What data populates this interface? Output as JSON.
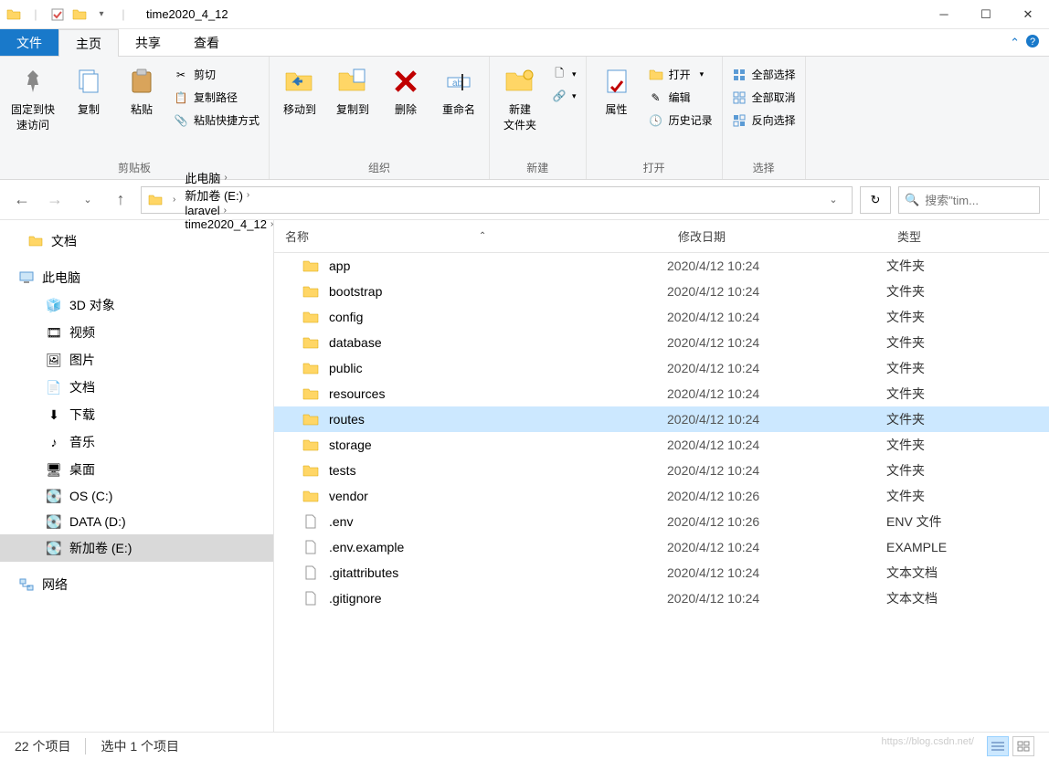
{
  "window": {
    "title": "time2020_4_12"
  },
  "tabs": {
    "file": "文件",
    "home": "主页",
    "share": "共享",
    "view": "查看"
  },
  "ribbon": {
    "clipboard": {
      "pin": "固定到快\n速访问",
      "copy": "复制",
      "paste": "粘贴",
      "cut": "剪切",
      "copypath": "复制路径",
      "paste_shortcut": "粘贴快捷方式",
      "label": "剪贴板"
    },
    "organize": {
      "moveto": "移动到",
      "copyto": "复制到",
      "delete": "删除",
      "rename": "重命名",
      "label": "组织"
    },
    "new": {
      "newfolder": "新建\n文件夹",
      "label": "新建"
    },
    "open": {
      "properties": "属性",
      "open": "打开",
      "edit": "编辑",
      "history": "历史记录",
      "label": "打开"
    },
    "select": {
      "all": "全部选择",
      "none": "全部取消",
      "invert": "反向选择",
      "label": "选择"
    }
  },
  "breadcrumb": {
    "items": [
      "此电脑",
      "新加卷 (E:)",
      "laravel",
      "time2020_4_12"
    ]
  },
  "search": {
    "placeholder": "搜索\"tim..."
  },
  "sidebar": {
    "docs": "文档",
    "pc": "此电脑",
    "items": [
      "3D 对象",
      "视频",
      "图片",
      "文档",
      "下载",
      "音乐",
      "桌面",
      "OS (C:)",
      "DATA (D:)",
      "新加卷 (E:)"
    ],
    "network": "网络"
  },
  "columns": {
    "name": "名称",
    "date": "修改日期",
    "type": "类型"
  },
  "files": [
    {
      "name": "app",
      "date": "2020/4/12 10:24",
      "type": "文件夹",
      "icon": "folder",
      "selected": false
    },
    {
      "name": "bootstrap",
      "date": "2020/4/12 10:24",
      "type": "文件夹",
      "icon": "folder",
      "selected": false
    },
    {
      "name": "config",
      "date": "2020/4/12 10:24",
      "type": "文件夹",
      "icon": "folder",
      "selected": false
    },
    {
      "name": "database",
      "date": "2020/4/12 10:24",
      "type": "文件夹",
      "icon": "folder",
      "selected": false
    },
    {
      "name": "public",
      "date": "2020/4/12 10:24",
      "type": "文件夹",
      "icon": "folder",
      "selected": false
    },
    {
      "name": "resources",
      "date": "2020/4/12 10:24",
      "type": "文件夹",
      "icon": "folder",
      "selected": false
    },
    {
      "name": "routes",
      "date": "2020/4/12 10:24",
      "type": "文件夹",
      "icon": "folder",
      "selected": true
    },
    {
      "name": "storage",
      "date": "2020/4/12 10:24",
      "type": "文件夹",
      "icon": "folder",
      "selected": false
    },
    {
      "name": "tests",
      "date": "2020/4/12 10:24",
      "type": "文件夹",
      "icon": "folder",
      "selected": false
    },
    {
      "name": "vendor",
      "date": "2020/4/12 10:26",
      "type": "文件夹",
      "icon": "folder",
      "selected": false
    },
    {
      "name": ".env",
      "date": "2020/4/12 10:26",
      "type": "ENV 文件",
      "icon": "file",
      "selected": false
    },
    {
      "name": ".env.example",
      "date": "2020/4/12 10:24",
      "type": "EXAMPLE",
      "icon": "file",
      "selected": false
    },
    {
      "name": ".gitattributes",
      "date": "2020/4/12 10:24",
      "type": "文本文档",
      "icon": "file",
      "selected": false
    },
    {
      "name": ".gitignore",
      "date": "2020/4/12 10:24",
      "type": "文本文档",
      "icon": "file",
      "selected": false
    }
  ],
  "status": {
    "count": "22 个项目",
    "selected": "选中 1 个项目"
  },
  "watermark": "https://blog.csdn.net/"
}
